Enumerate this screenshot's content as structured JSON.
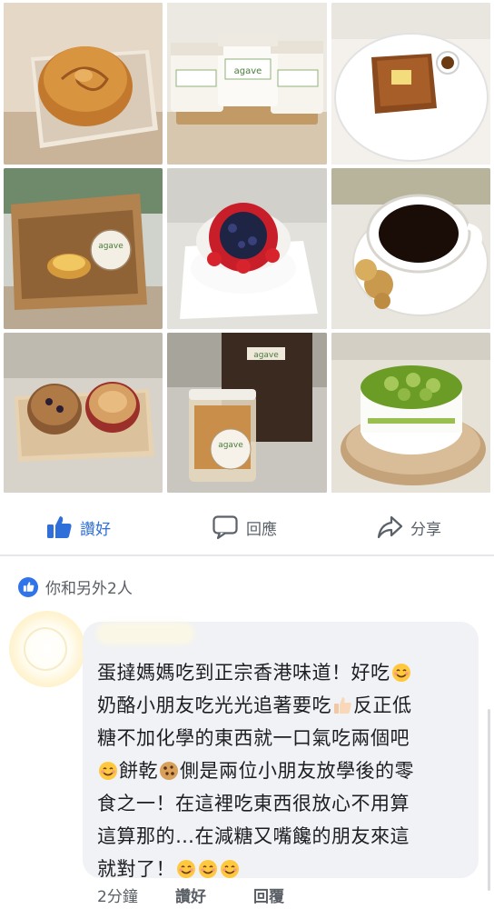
{
  "photos": {
    "agave_logo": "agave",
    "tiles": [
      {
        "subject": "bread-bun"
      },
      {
        "subject": "agave-jars"
      },
      {
        "subject": "french-toast"
      },
      {
        "subject": "egg-tart-box"
      },
      {
        "subject": "berry-cake"
      },
      {
        "subject": "coffee-cookies"
      },
      {
        "subject": "muffins"
      },
      {
        "subject": "cookie-jar"
      },
      {
        "subject": "kiwi-cake"
      }
    ]
  },
  "actions": {
    "like_label": "讚好",
    "comment_label": "回應",
    "share_label": "分享"
  },
  "reactions": {
    "text": "你和另外2人"
  },
  "comment": {
    "lines": [
      "蛋撻媽媽吃到正宗香港味道！好吃",
      "奶酪小朋友吃光光追著要吃",
      "反正低",
      "糖不加化學的東西就一口氣吃兩個吧",
      "餅乾",
      "側是兩位小朋友放學後的零",
      "食之一！在這裡吃東西很放心不用算",
      "這算那的…在減糖又嘴饞的朋友來這",
      "就對了！"
    ],
    "time": "2分鐘",
    "like": "讚好",
    "reply": "回覆"
  },
  "colors": {
    "accent": "#2e6fd9",
    "bubble": "#f0f2f5",
    "text": "#1c1e21",
    "muted": "#5a5f66"
  },
  "icons": [
    "thumbs-up-icon",
    "comment-icon",
    "share-icon",
    "smile-emoji-icon",
    "thumbs-up-emoji-icon",
    "cookie-emoji-icon"
  ]
}
